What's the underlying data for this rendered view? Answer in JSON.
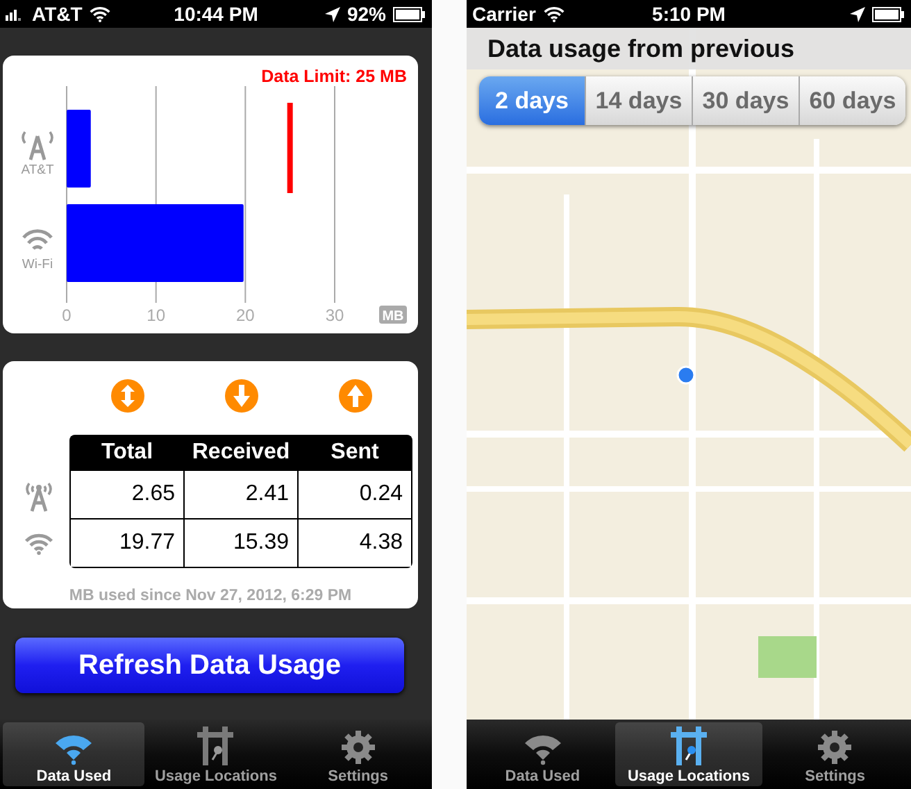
{
  "left_screen": {
    "status_bar": {
      "carrier": "AT&T",
      "time": "10:44 PM",
      "battery": "92%"
    },
    "chart_card": {
      "chart_data": {
        "type": "bar",
        "orientation": "horizontal",
        "categories": [
          "AT&T",
          "Wi-Fi"
        ],
        "values": [
          2.7,
          19.8
        ],
        "xlabel": "MB",
        "xlim": [
          0,
          30
        ],
        "xticks": [
          0,
          10,
          20,
          30
        ],
        "grid": true,
        "ref_lines": [
          {
            "axis": "x",
            "value": 25,
            "label": "Data Limit: 25 MB"
          }
        ]
      }
    },
    "usage_card": {
      "columns": [
        {
          "label": "Total",
          "kind": "both"
        },
        {
          "label": "Received",
          "kind": "down"
        },
        {
          "label": "Sent",
          "kind": "up"
        }
      ],
      "rows": [
        {
          "kind": "cellular",
          "values": [
            "2.65",
            "2.41",
            "0.24"
          ]
        },
        {
          "kind": "wifi",
          "values": [
            "19.77",
            "15.39",
            "4.38"
          ]
        }
      ],
      "footnote": "MB used since Nov 27, 2012, 6:29 PM"
    },
    "refresh_button": "Refresh Data Usage",
    "tab_bar": [
      {
        "label": "Data Used",
        "kind": "data",
        "selected": true
      },
      {
        "label": "Usage Locations",
        "kind": "locations",
        "selected": false
      },
      {
        "label": "Settings",
        "kind": "settings",
        "selected": false
      }
    ]
  },
  "right_screen": {
    "status_bar": {
      "carrier": "Carrier",
      "time": "5:10 PM"
    },
    "header": "Data usage from previous",
    "period_tabs": [
      {
        "label": "2 days",
        "selected": true
      },
      {
        "label": "14 days",
        "selected": false
      },
      {
        "label": "30 days",
        "selected": false
      },
      {
        "label": "60 days",
        "selected": false
      }
    ],
    "tab_bar": [
      {
        "label": "Data Used",
        "kind": "data",
        "selected": false
      },
      {
        "label": "Usage Locations",
        "kind": "locations",
        "selected": true
      },
      {
        "label": "Settings",
        "kind": "settings",
        "selected": false
      }
    ]
  }
}
